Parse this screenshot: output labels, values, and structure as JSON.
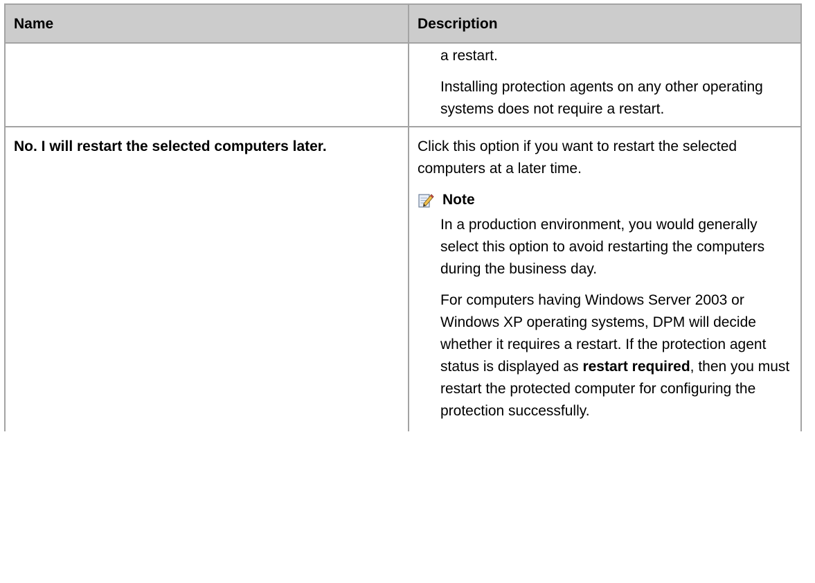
{
  "table": {
    "headers": {
      "name": "Name",
      "description": "Description"
    },
    "rows": [
      {
        "name": "",
        "description": {
          "continued_line": "a restart.",
          "paragraph": "Installing protection agents on any other operating systems does not require a restart."
        }
      },
      {
        "name": "No. I will restart the selected computers later.",
        "description": {
          "intro": "Click this option if you want to restart the selected computers at a later time.",
          "note": {
            "icon": "note-pencil-icon",
            "title": "Note",
            "paragraph1": "In a production environment, you would generally select this option to avoid restarting the computers during the business day.",
            "paragraph2_before": "For computers having Windows Server 2003 or Windows XP operating systems, DPM will decide whether it requires a restart. If the protection agent status is displayed as ",
            "paragraph2_bold": "restart required",
            "paragraph2_after": ", then you must restart the protected computer for configuring the protection successfully."
          }
        }
      }
    ]
  }
}
